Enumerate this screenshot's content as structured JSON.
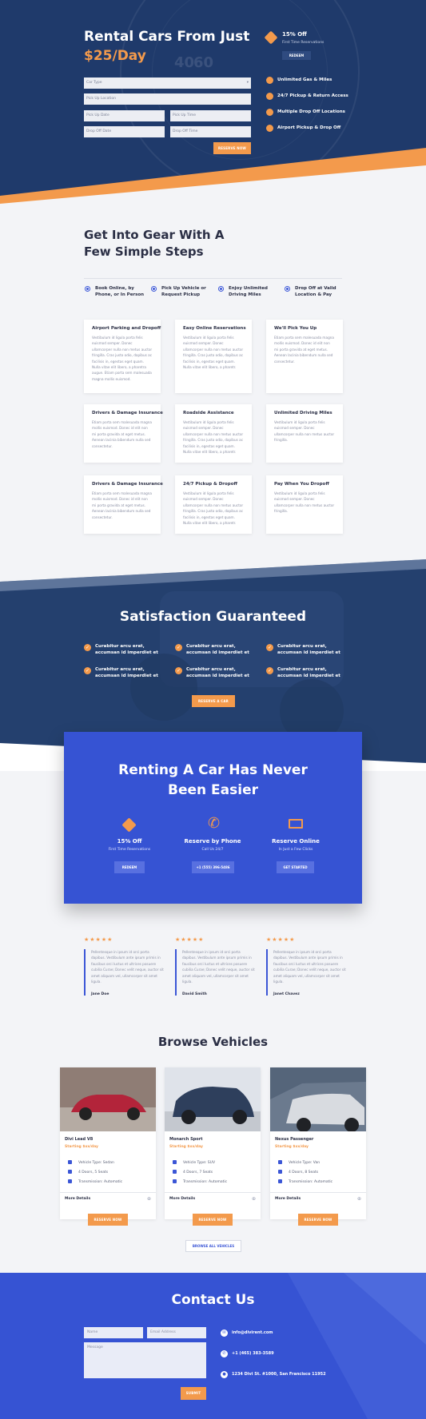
{
  "hero": {
    "title": "Rental Cars From Just",
    "price": "$25/Day",
    "fields": {
      "car_type": "Car Type",
      "pickup_location": "Pick Up Location",
      "pickup_date": "Pick Up Date",
      "pickup_time": "Pick Up Time",
      "dropoff_date": "Drop Off Date",
      "dropoff_time": "Drop Off Time"
    },
    "reserve_label": "RESERVE NOW",
    "promo": {
      "title": "15% Off",
      "subtitle": "First Time Reservations",
      "button": "REDEEM"
    },
    "features": [
      "Unlimited Gas & Miles",
      "24/7 Pickup & Return Access",
      "Multiple Drop Off Locations",
      "Airport Pickup & Drop Off"
    ],
    "gauge_numbers": [
      "40",
      "60"
    ]
  },
  "steps": {
    "heading": "Get Into Gear With A Few Simple Steps",
    "items": [
      "Book Online, by Phone, or In Person",
      "Pick Up Vehicle or Request Pickup",
      "Enjoy Unlimited Driving Miles",
      "Drop Off at Valid Location & Pay"
    ]
  },
  "services": [
    {
      "title": "Airport Parking and Dropoff",
      "text": "Vestibulum id ligula porta felis euismod semper. Donec ullamcorper nulla non metus auctor fringilla. Cras justo odio, dapibus ac facilisis in, egestas eget quam. Nulla vitae elit libero, a pharetra augue. Etiam porta sem malesuada magna mollis euismod."
    },
    {
      "title": "Easy Online Reservations",
      "text": "Vestibulum id ligula porta felis euismod semper. Donec ullamcorper nulla non metus auctor fringilla. Cras justo odio, dapibus ac facilisis in, egestas eget quam. Nulla vitae elit libero, a pharetr."
    },
    {
      "title": "We'll Pick You Up",
      "text": "Etiam porta sem malesuada magna mollis euismod. Donec id elit non mi porta gravida at eget metus. Aenean lacinia bibendum nulla sed consectetur."
    },
    {
      "title": "Drivers & Damage Insurance",
      "text": "Etiam porta sem malesuada magna mollis euismod. Donec id elit non mi porta gravida at eget metus. Aenean lacinia bibendum nulla sed consectetur."
    },
    {
      "title": "Roadside Assistance",
      "text": "Vestibulum id ligula porta felis euismod semper. Donec ullamcorper nulla non metus auctor fringilla. Cras justo odio, dapibus ac facilisis in, egestas eget quam. Nulla vitae elit libero, a pharetr."
    },
    {
      "title": "Unlimited Driving Miles",
      "text": "Vestibulum id ligula porta felis euismod semper. Donec ullamcorper nulla non metus auctor fringilla."
    },
    {
      "title": "Drivers & Damage Insurance",
      "text": "Etiam porta sem malesuada magna mollis euismod. Donec id elit non mi porta gravida at eget metus. Aenean lacinia bibendum nulla sed consectetur."
    },
    {
      "title": "24/7 Pickup & Dropoff",
      "text": "Vestibulum id ligula porta felis euismod semper. Donec ullamcorper nulla non metus auctor fringilla. Cras justo odio, dapibus ac facilisis in, egestas eget quam. Nulla vitae elit libero, a pharetr."
    },
    {
      "title": "Pay When You Dropoff",
      "text": "Vestibulum id ligula porta felis euismod semper. Donec ullamcorper nulla non metus auctor fringilla."
    }
  ],
  "satisfaction": {
    "heading": "Satisfaction Guaranteed",
    "items": [
      "Curabitur arcu erat, accumsan id imperdiet et",
      "Curabitur arcu erat, accumsan id imperdiet et",
      "Curabitur arcu erat, accumsan id imperdiet et",
      "Curabitur arcu erat, accumsan id imperdiet et",
      "Curabitur arcu erat, accumsan id imperdiet et",
      "Curabitur arcu erat, accumsan id imperdiet et"
    ],
    "button": "RESERVE A CAR"
  },
  "renting": {
    "heading": "Renting A Car Has Never Been Easier",
    "columns": [
      {
        "title": "15% Off",
        "subtitle": "First Time Reservations",
        "button": "REDEEM",
        "icon": "tag-icon"
      },
      {
        "title": "Reserve by Phone",
        "subtitle": "Call Us 24/7",
        "button": "+1 (555) 396-5486",
        "icon": "phone-icon"
      },
      {
        "title": "Reserve Online",
        "subtitle": "In Just a Few Clicks",
        "button": "GET STARTED",
        "icon": "monitor-icon"
      }
    ]
  },
  "testimonials": [
    {
      "stars": "★★★★★",
      "text": "Pellentesque in ipsum id orci porta dapibus. Vestibulum ante ipsum primis in faucibus orci luctus et ultrices posuere cubilia Curae; Donec velit neque, auctor sit amet aliquam vel, ullamcorper sit amet ligula.",
      "name": "Jane Doe"
    },
    {
      "stars": "★★★★★",
      "text": "Pellentesque in ipsum id orci porta dapibus. Vestibulum ante ipsum primis in faucibus orci luctus et ultrices posuere cubilia Curae; Donec velit neque, auctor sit amet aliquam vel, ullamcorper sit amet ligula.",
      "name": "David Smith"
    },
    {
      "stars": "★★★★★",
      "text": "Pellentesque in ipsum id orci porta dapibus. Vestibulum ante ipsum primis in faucibus orci luctus et ultrices posuere cubilia Curae; Donec velit neque, auctor sit amet aliquam vel, ullamcorper sit amet ligula.",
      "name": "Janet Chavez"
    }
  ],
  "vehicles": {
    "heading": "Browse Vehicles",
    "items": [
      {
        "name": "Divi Lead V8",
        "price": "Starting $xx/day",
        "specs": [
          "Vehicle Type: Sedan",
          "4 Doors, 5 Seats",
          "Transmission: Automatic"
        ],
        "details": "More Details",
        "button": "RESERVE NOW",
        "color": "#b3243a"
      },
      {
        "name": "Monarch Sport",
        "price": "Starting $xx/day",
        "specs": [
          "Vehicle Type: SUV",
          "4 Doors, 7 Seats",
          "Transmission: Automatic"
        ],
        "details": "More Details",
        "button": "RESERVE NOW",
        "color": "#2e3f5c"
      },
      {
        "name": "Nexus Passenger",
        "price": "Starting $xx/day",
        "specs": [
          "Vehicle Type: Van",
          "4 Doors, 8 Seats",
          "Transmission: Automatic"
        ],
        "details": "More Details",
        "button": "RESERVE NOW",
        "color": "#d8dbe0"
      }
    ],
    "browse_all": "BROWSE ALL VEHICLES"
  },
  "contact": {
    "heading": "Contact Us",
    "name_placeholder": "Name",
    "email_placeholder": "Email Address",
    "message_placeholder": "Message",
    "submit": "SUBMIT",
    "email": "info@divirent.com",
    "phone": "+1 (465) 383-3589",
    "address": "1234 Divi St. #1000, San Francisco 11952"
  },
  "colors": {
    "accent": "#f39a4c",
    "brand_blue": "#3653d3",
    "navy": "#1f3a6b"
  }
}
